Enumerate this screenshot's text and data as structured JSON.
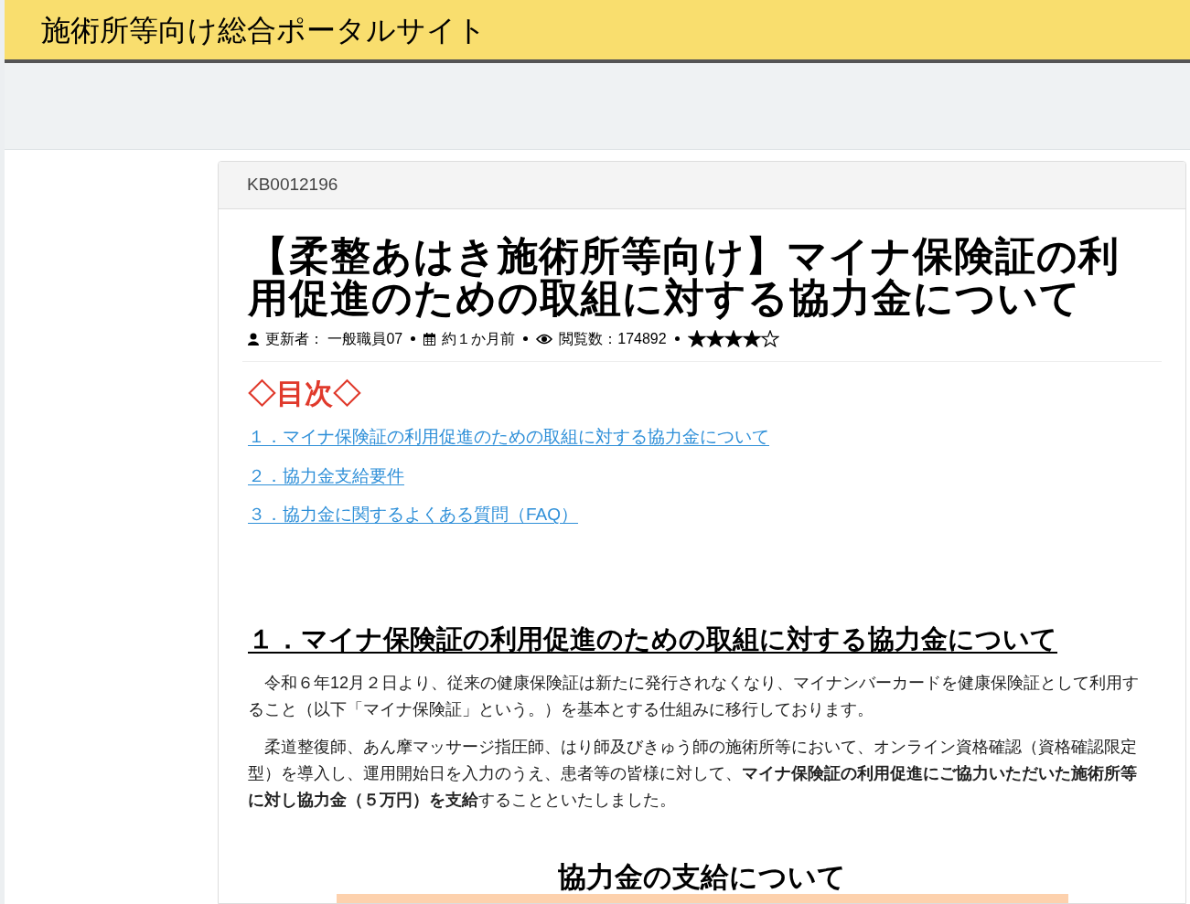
{
  "site_title": "施術所等向け総合ポータルサイト",
  "article": {
    "id": "KB0012196",
    "title": "【柔整あはき施術所等向け】マイナ保険証の利用促進のための取組に対する協力金について",
    "meta": {
      "updater": "更新者： 一般職員07",
      "updated": "約１か月前",
      "views": "閲覧数：174892",
      "stars": 4
    },
    "toc_heading": "◇目次◇",
    "toc": [
      "１．マイナ保険証の利用促進のための取組に対する協力金について",
      "２．協力金支給要件",
      "３．協力金に関するよくある質問（FAQ）"
    ],
    "section_heading": "１．マイナ保険証の利用促進のための取組に対する協力金について",
    "paragraphs": [
      "　令和６年12月２日より、従来の健康保険証は新たに発行されなくなり、マイナンバーカードを健康保険証として利用すること（以下「マイナ保険証」という。）を基本とする仕組みに移行しております。",
      "　柔道整復師、あん摩マッサージ指圧師、はり師及びきゅう師の施術所等において、オンライン資格確認（資格確認限定型）を導入し、運用開始日を入力のうえ、患者等の皆様に対して、**マイナ保険証の利用促進にご協力いただいた施術所等に対し協力金（５万円）を支給**することといたしました。"
    ],
    "subheading": "協力金の支給について"
  }
}
